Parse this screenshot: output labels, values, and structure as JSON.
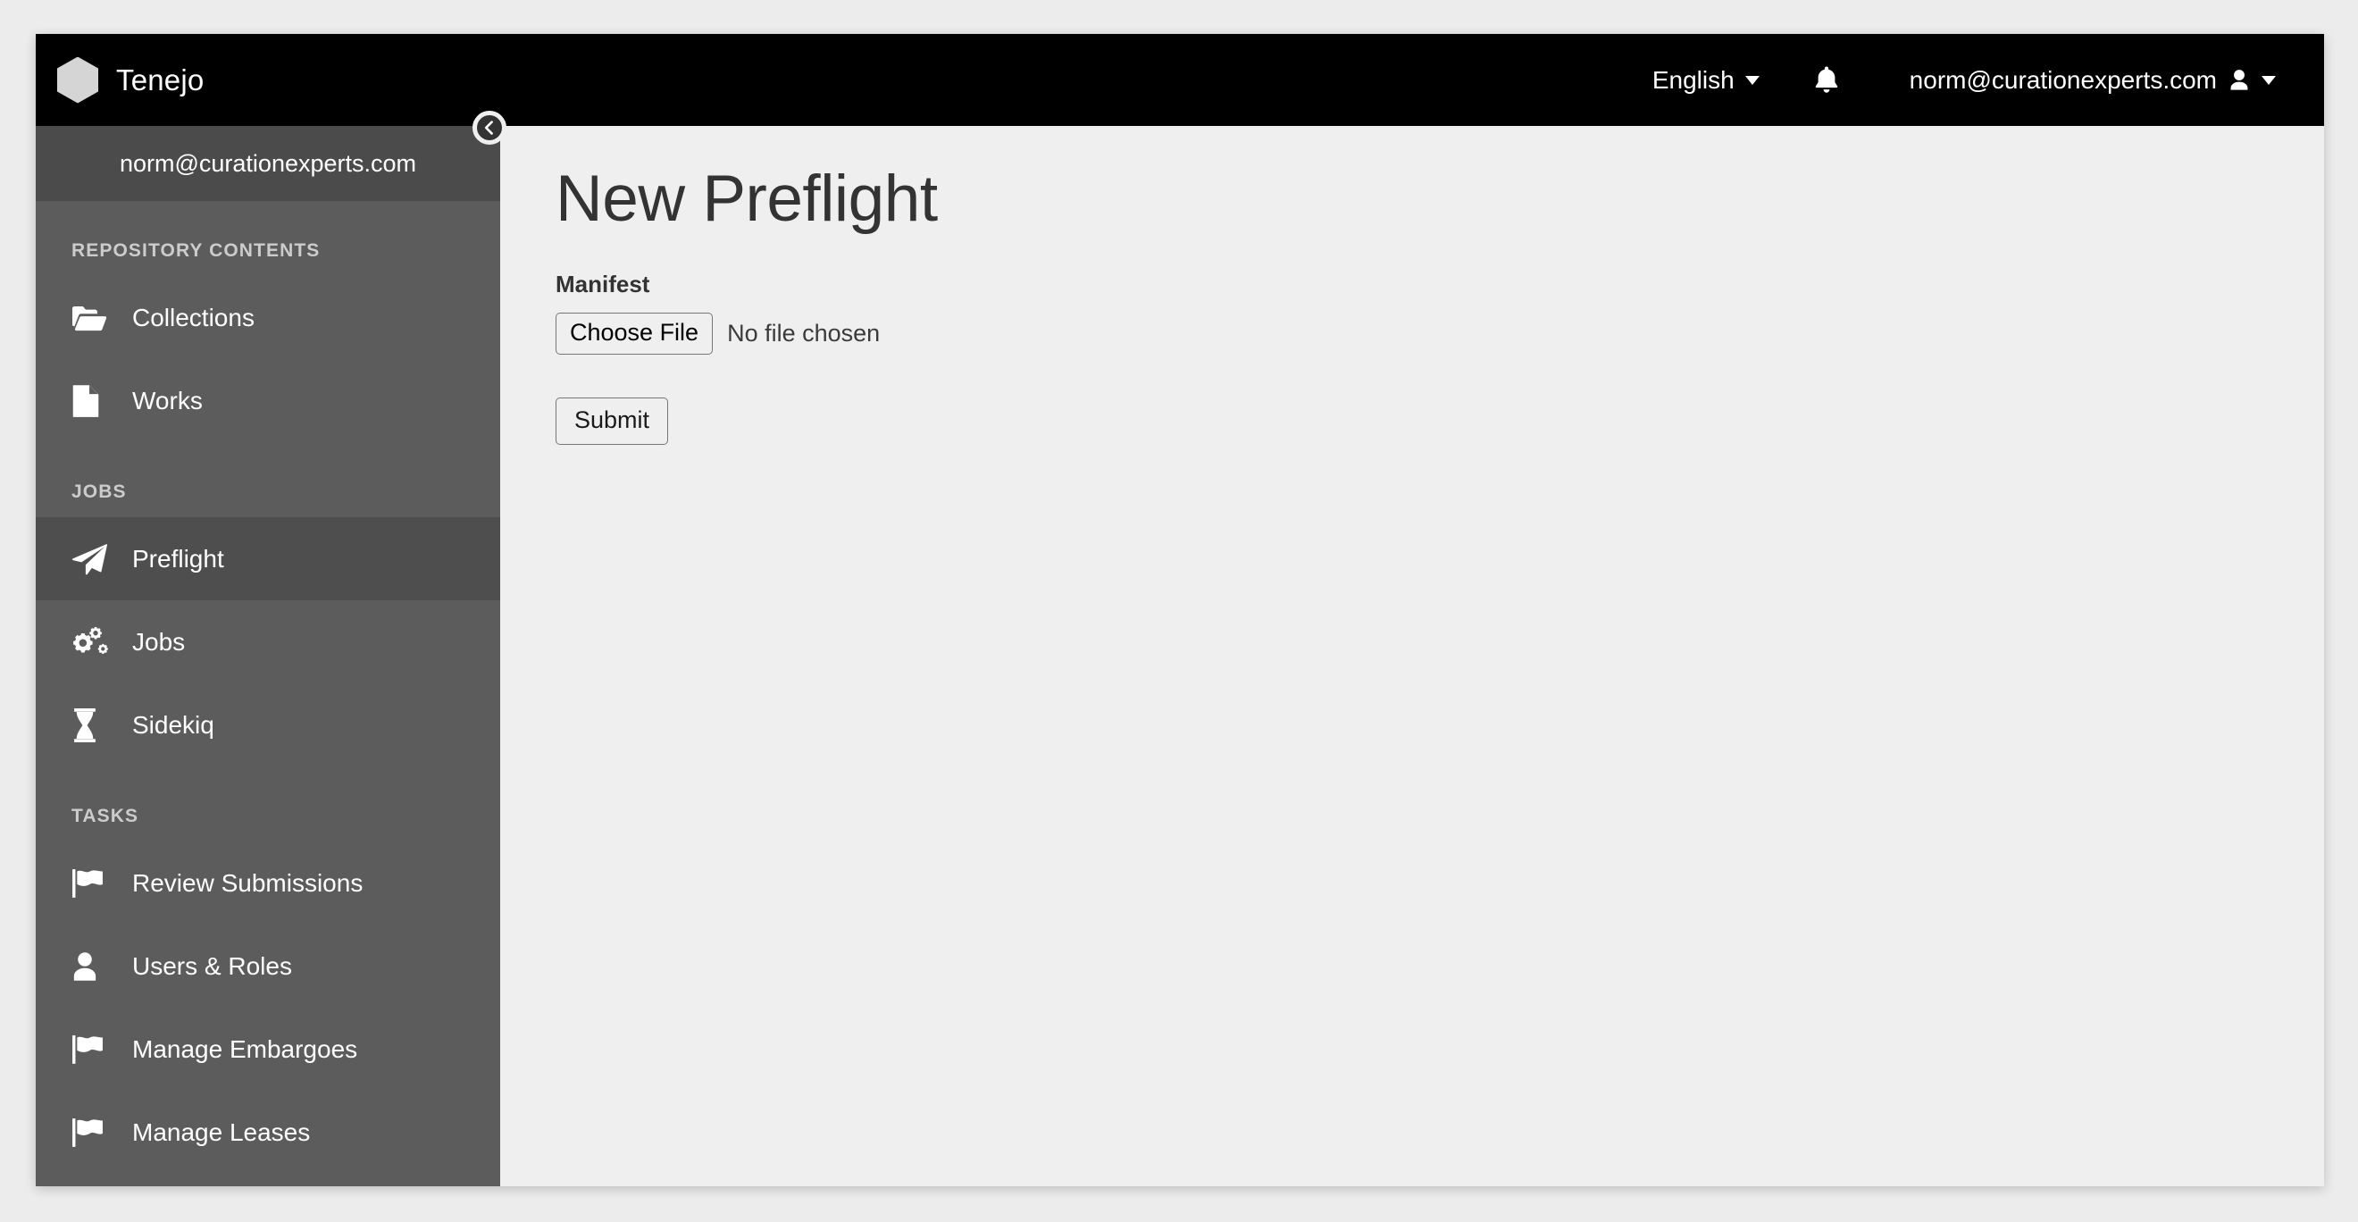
{
  "topbar": {
    "brand_name": "Tenejo",
    "logo_icon": "hexagon-logo-icon",
    "language_label": "English",
    "language_caret_icon": "chevron-down-icon",
    "notifications_icon": "bell-icon",
    "user_email": "norm@curationexperts.com",
    "user_icon": "user-icon",
    "user_caret_icon": "chevron-down-icon"
  },
  "sidebar": {
    "account_email": "norm@curationexperts.com",
    "collapse_icon": "chevron-left-circle-icon",
    "sections": [
      {
        "label": "REPOSITORY CONTENTS",
        "items": [
          {
            "label": "Collections",
            "icon": "folder-open-icon",
            "active": false
          },
          {
            "label": "Works",
            "icon": "file-icon",
            "active": false
          }
        ]
      },
      {
        "label": "JOBS",
        "items": [
          {
            "label": "Preflight",
            "icon": "paper-plane-icon",
            "active": true
          },
          {
            "label": "Jobs",
            "icon": "cogs-icon",
            "active": false
          },
          {
            "label": "Sidekiq",
            "icon": "hourglass-icon",
            "active": false
          }
        ]
      },
      {
        "label": "TASKS",
        "items": [
          {
            "label": "Review Submissions",
            "icon": "flag-icon",
            "active": false
          },
          {
            "label": "Users & Roles",
            "icon": "user-icon",
            "active": false
          },
          {
            "label": "Manage Embargoes",
            "icon": "flag-icon",
            "active": false
          },
          {
            "label": "Manage Leases",
            "icon": "flag-icon",
            "active": false
          }
        ]
      }
    ]
  },
  "main": {
    "page_title": "New Preflight",
    "manifest_label": "Manifest",
    "choose_file_label": "Choose File",
    "file_status": "No file chosen",
    "submit_label": "Submit"
  },
  "colors": {
    "topbar_bg": "#000000",
    "sidebar_bg": "#5c5c5c",
    "sidebar_head_bg": "#4b4b4b",
    "sidebar_active_bg": "#4e4e4e",
    "content_bg": "#efefef",
    "page_bg": "#ececec",
    "title_text": "#333333",
    "section_label": "#cccccc"
  }
}
